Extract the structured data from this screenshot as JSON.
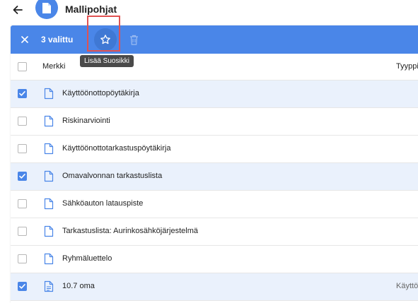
{
  "header": {
    "title": "Mallipohjat"
  },
  "selection": {
    "count_label": "3 valittu"
  },
  "tooltip": {
    "text": "Lisää Suosikki"
  },
  "table": {
    "columns": {
      "name": "Merkki",
      "type": "Tyyppi"
    },
    "rows": [
      {
        "name": "Käyttöönottopöytäkirja",
        "type": "",
        "selected": true,
        "icon": "file-icon"
      },
      {
        "name": "Riskinarviointi",
        "type": "",
        "selected": false,
        "icon": "file-icon"
      },
      {
        "name": "Käyttöönottotarkastuspöytäkirja",
        "type": "",
        "selected": false,
        "icon": "file-icon"
      },
      {
        "name": "Omavalvonnan tarkastuslista",
        "type": "",
        "selected": true,
        "icon": "file-icon"
      },
      {
        "name": "Sähköauton latauspiste",
        "type": "",
        "selected": false,
        "icon": "file-icon"
      },
      {
        "name": "Tarkastuslista: Aurinkosähköjärjestelmä",
        "type": "",
        "selected": false,
        "icon": "file-icon"
      },
      {
        "name": "Ryhmäluettelo",
        "type": "",
        "selected": false,
        "icon": "file-icon"
      },
      {
        "name": "10.7 oma",
        "type": "Käyttö",
        "selected": true,
        "icon": "document-text-icon"
      }
    ]
  },
  "colors": {
    "primary": "#4a86e8",
    "selected_row": "#eaf1fc",
    "highlight": "#e05252"
  }
}
